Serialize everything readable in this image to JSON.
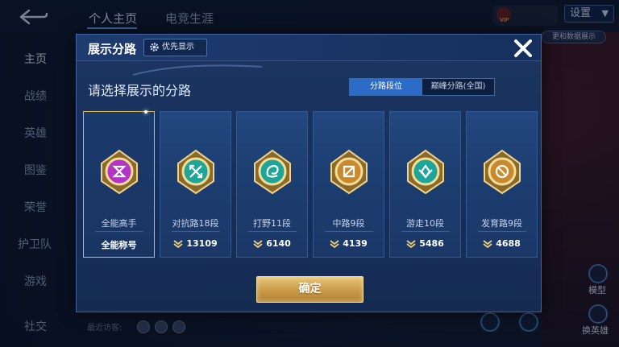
{
  "background": {
    "tabs": [
      "个人主页",
      "电竞生涯"
    ],
    "vip_label": "VIP",
    "settings_label": "设置",
    "sidebar": [
      "主页",
      "战绩",
      "英雄",
      "图鉴",
      "荣誉",
      "护卫队",
      "游戏",
      "社交"
    ],
    "recent_label": "最近访客:",
    "right_pill": "更和数据展示",
    "right_labels": [
      "模型",
      "换英雄"
    ]
  },
  "modal": {
    "title": "展示分路",
    "priority_label": "优先显示",
    "subtitle": "请选择展示的分路",
    "segments": [
      "分路段位",
      "巅峰分路(全国)"
    ],
    "cards": [
      {
        "name": "全能高手",
        "stat": "全能称号",
        "show_icon": false,
        "badge_color": "#b334c6",
        "selected": true
      },
      {
        "name": "对抗路18段",
        "stat": "13109",
        "show_icon": true,
        "badge_color": "#1ea59a",
        "selected": false
      },
      {
        "name": "打野11段",
        "stat": "6140",
        "show_icon": true,
        "badge_color": "#1ea59a",
        "selected": false
      },
      {
        "name": "中路9段",
        "stat": "4139",
        "show_icon": true,
        "badge_color": "#c9892e",
        "selected": false
      },
      {
        "name": "游走10段",
        "stat": "5486",
        "show_icon": true,
        "badge_color": "#1ea59a",
        "selected": false
      },
      {
        "name": "发育路9段",
        "stat": "4688",
        "show_icon": true,
        "badge_color": "#c9892e",
        "selected": false
      }
    ],
    "confirm_label": "确定"
  },
  "colors": {
    "accent_blue": "#2c6cc8",
    "gold": "#d8b45a",
    "panel": "#17305a"
  }
}
